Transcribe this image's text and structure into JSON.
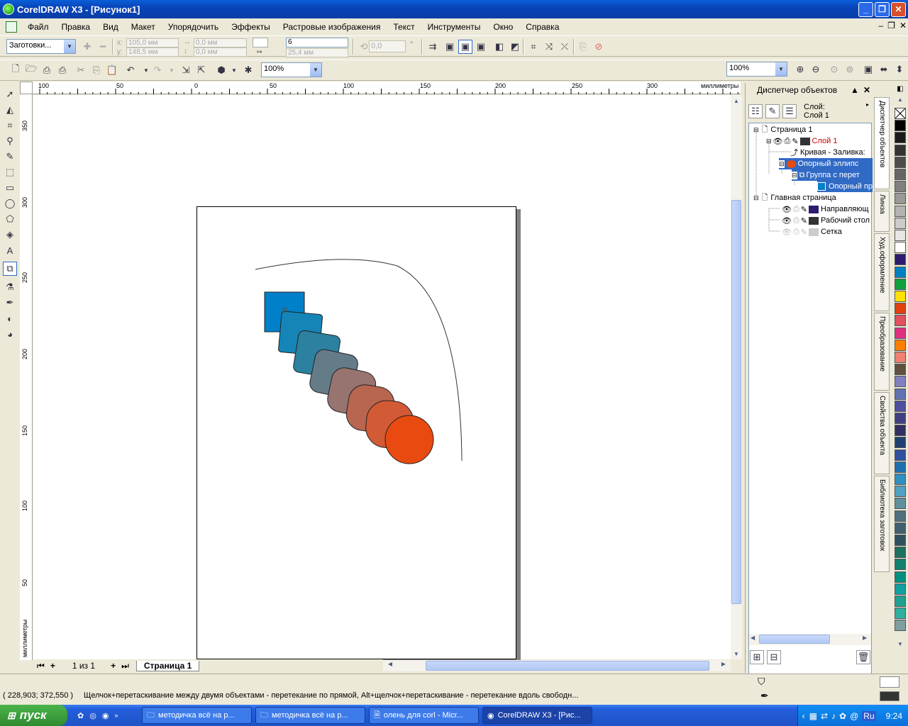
{
  "window": {
    "title": "CorelDRAW X3 - [Рисунок1]"
  },
  "menu": [
    "Файл",
    "Правка",
    "Вид",
    "Макет",
    "Упорядочить",
    "Эффекты",
    "Растровые изображения",
    "Текст",
    "Инструменты",
    "Окно",
    "Справка"
  ],
  "propbar": {
    "presets": "Заготовки...",
    "x": "105,0 мм",
    "y": "148,5 мм",
    "w": "0,0 мм",
    "h": "0,0 мм",
    "steps": "6",
    "spacing": "25,4 мм",
    "angle": "0,0",
    "deg": "°"
  },
  "stdbar": {
    "zoom_left": "100%",
    "zoom_right": "100%"
  },
  "hruler": {
    "labels": [
      "100",
      "50",
      "0",
      "50",
      "100",
      "150",
      "200",
      "250",
      "300"
    ],
    "units": "миллиметры"
  },
  "vruler": {
    "labels": [
      "350",
      "300",
      "250",
      "200",
      "150",
      "100",
      "50"
    ],
    "units": "миллиметры"
  },
  "pagebar": {
    "counter": "1 из 1",
    "tab": "Страница 1"
  },
  "docker": {
    "title": "Диспетчер объектов",
    "layer_label": "Слой:",
    "layer_value": "Слой 1",
    "tree": [
      {
        "text": "Страница 1",
        "level": 0
      },
      {
        "text": "Слой 1",
        "level": 1
      },
      {
        "text": "Кривая - Заливка:",
        "level": 2
      },
      {
        "text": "Опорный эллипс",
        "level": 2
      },
      {
        "text": "Группа с перет",
        "level": 3
      },
      {
        "text": "Опорный пр",
        "level": 4
      },
      {
        "text": "Главная страница",
        "level": 0
      },
      {
        "text": "Направляющ",
        "level": 1
      },
      {
        "text": "Рабочий стол",
        "level": 1
      },
      {
        "text": "Сетка",
        "level": 1
      }
    ],
    "tabs": [
      "Диспетчер объектов",
      "Линза",
      "Худ.оформление",
      "Преобразование",
      "Свойства объекта",
      "Библиотека заготовок"
    ]
  },
  "palette": [
    "#ffffff",
    "#000000",
    "#1a1a1a",
    "#333333",
    "#4d4d4d",
    "#666666",
    "#808080",
    "#999999",
    "#b3b3b3",
    "#cccccc",
    "#e6e6e6",
    "#ffffff",
    "#2e1a6e",
    "#0080c0",
    "#10a040",
    "#ffe000",
    "#e04010",
    "#e05060",
    "#e03080",
    "#ff8000",
    "#f08070",
    "#605040",
    "#8080c0",
    "#6070b0",
    "#5050a0",
    "#404080",
    "#303060",
    "#204070",
    "#3050a0",
    "#2070b0",
    "#3090c0",
    "#50a0c0",
    "#6090a0",
    "#507080",
    "#406070",
    "#305060",
    "#207060",
    "#108070",
    "#009080",
    "#10a0a0",
    "#20a090",
    "#30b0a0",
    "#80a0a0"
  ],
  "status": {
    "coords": "( 228,903; 372,550 )",
    "hint": "Щелчок+перетаскивание между двумя объектами - перетекание по прямой, Alt+щелчок+перетаскивание - перетекание вдоль свободн..."
  },
  "taskbar": {
    "start": "пуск",
    "tasks": [
      "методичка всё на р...",
      "методичка всё на р...",
      "олень для corl - Micr...",
      "CorelDRAW X3 - [Рис..."
    ],
    "lang": "Ru",
    "time": "9:24"
  },
  "drawing": {
    "blend_colors": [
      "#0080c8",
      "#1585b8",
      "#2c80a0",
      "#647c88",
      "#987470",
      "#b86650",
      "#d25a34",
      "#e84a10"
    ]
  }
}
